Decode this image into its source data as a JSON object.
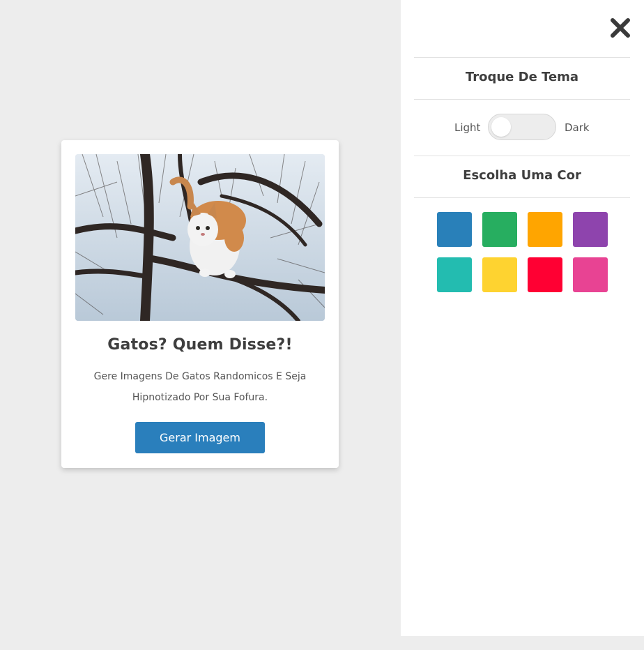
{
  "card": {
    "image_alt": "cat-photo",
    "title": "Gatos? Quem Disse?!",
    "description": "Gere Imagens De Gatos Randomicos E Seja Hipnotizado Por Sua Fofura.",
    "button_label": "Gerar Imagem",
    "button_color": "#2a7fbc"
  },
  "panel": {
    "close_icon": "close-icon",
    "theme_title": "Troque De Tema",
    "theme_light_label": "Light",
    "theme_dark_label": "Dark",
    "theme_state": "light",
    "color_title": "Escolha Uma Cor",
    "colors": [
      "#2980b9",
      "#27ae60",
      "#ffa500",
      "#8e44ad",
      "#23bcb0",
      "#fed330",
      "#ff0033",
      "#e84393"
    ]
  }
}
